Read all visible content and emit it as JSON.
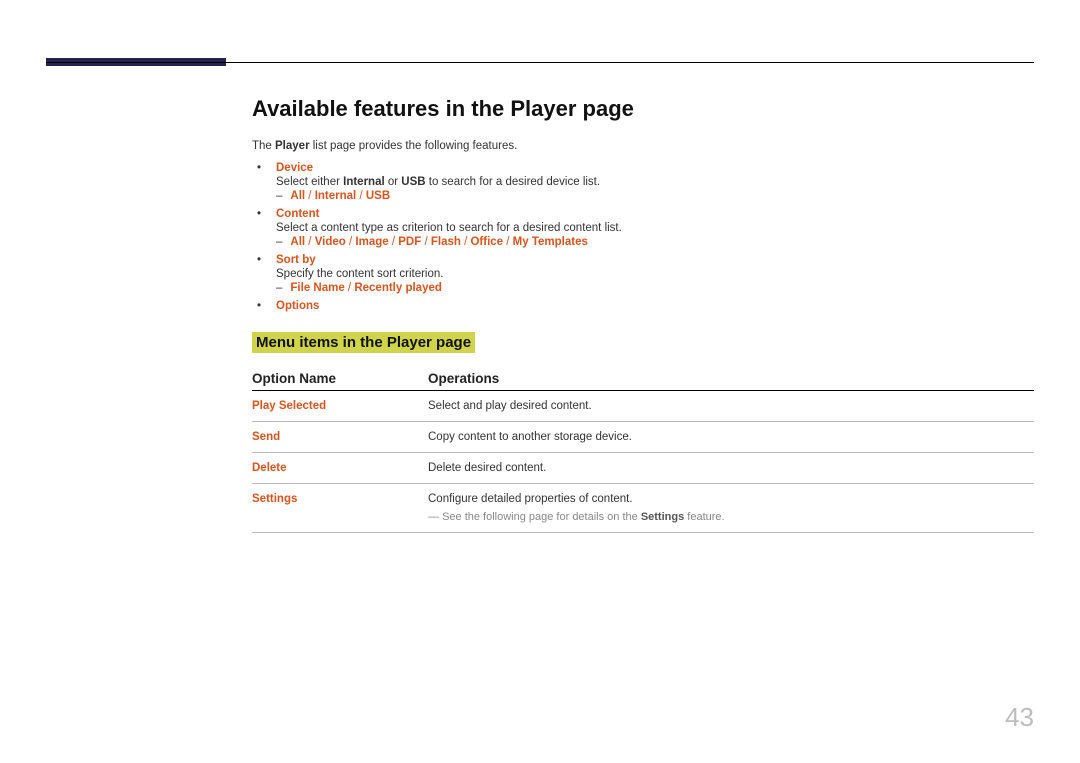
{
  "heading": "Available features in the Player page",
  "intro": {
    "pre": "The ",
    "bold": "Player",
    "post": " list page provides the following features."
  },
  "features": [
    {
      "name": "Device",
      "desc_parts": [
        "Select either ",
        "Internal",
        " or ",
        "USB",
        " to search for a desired device list."
      ],
      "sub": [
        "All",
        "Internal",
        "USB"
      ]
    },
    {
      "name": "Content",
      "desc_parts": [
        "Select a content type as criterion to search for a desired content list."
      ],
      "sub": [
        "All",
        "Video",
        "Image",
        "PDF",
        "Flash",
        "Office",
        "My Templates"
      ]
    },
    {
      "name": "Sort by",
      "desc_parts": [
        "Specify the content sort criterion."
      ],
      "sub": [
        "File Name",
        "Recently played"
      ]
    },
    {
      "name": "Options"
    }
  ],
  "subheading": "Menu items in the Player page",
  "table": {
    "headers": [
      "Option Name",
      "Operations"
    ],
    "rows": [
      {
        "name": "Play Selected",
        "ops": "Select and play desired content."
      },
      {
        "name": "Send",
        "ops": "Copy content to another storage device."
      },
      {
        "name": "Delete",
        "ops": "Delete desired content."
      },
      {
        "name": "Settings",
        "ops": "Configure detailed properties of content.",
        "note_pre": "See the following page for details on the ",
        "note_bold": "Settings",
        "note_post": " feature."
      }
    ]
  },
  "page_number": "43"
}
